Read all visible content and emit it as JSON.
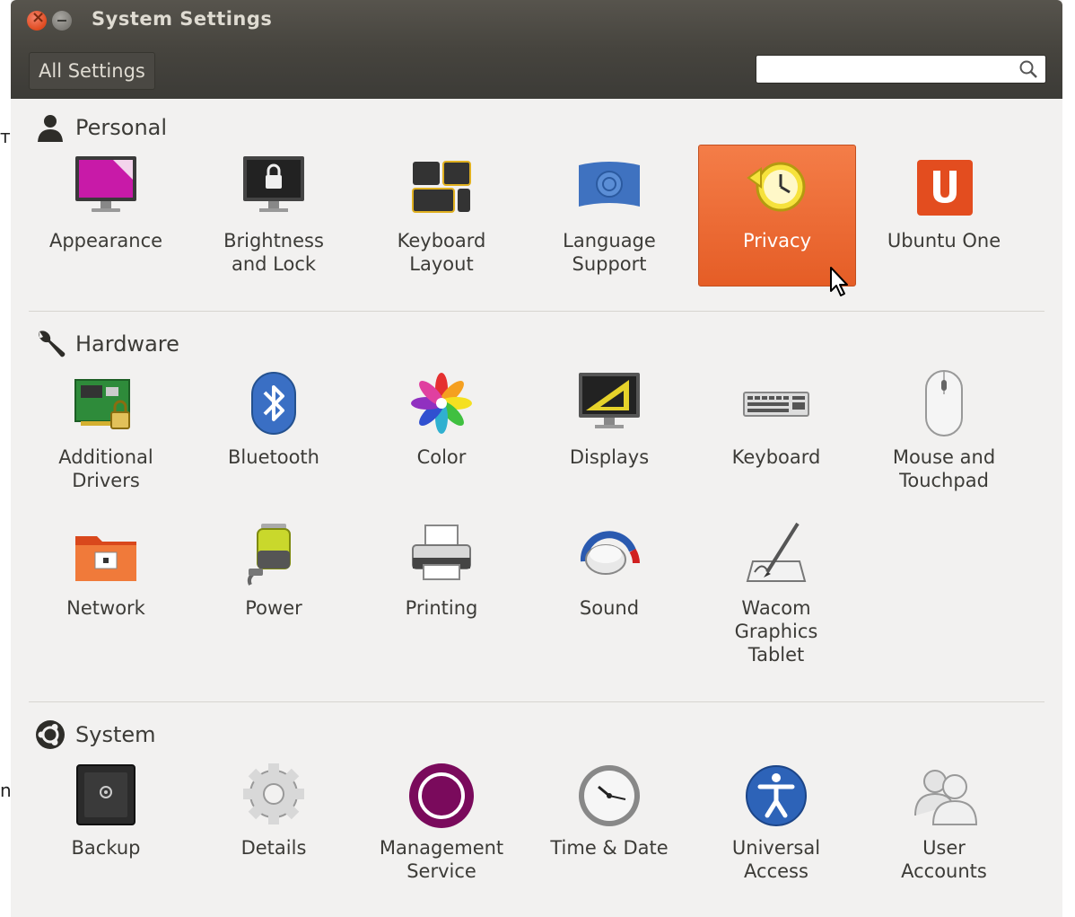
{
  "stray_text": {
    "top": "т",
    "bottom": "n"
  },
  "window": {
    "title": "System Settings",
    "all_settings_label": "All Settings",
    "search_placeholder": ""
  },
  "sections": {
    "personal": {
      "title": "Personal",
      "items": [
        {
          "label": "Appearance"
        },
        {
          "label": "Brightness\nand Lock"
        },
        {
          "label": "Keyboard\nLayout"
        },
        {
          "label": "Language\nSupport"
        },
        {
          "label": "Privacy",
          "selected": true
        },
        {
          "label": "Ubuntu One"
        }
      ]
    },
    "hardware": {
      "title": "Hardware",
      "items": [
        {
          "label": "Additional\nDrivers"
        },
        {
          "label": "Bluetooth"
        },
        {
          "label": "Color"
        },
        {
          "label": "Displays"
        },
        {
          "label": "Keyboard"
        },
        {
          "label": "Mouse and\nTouchpad"
        },
        {
          "label": "Network"
        },
        {
          "label": "Power"
        },
        {
          "label": "Printing"
        },
        {
          "label": "Sound"
        },
        {
          "label": "Wacom\nGraphics\nTablet"
        }
      ]
    },
    "system": {
      "title": "System",
      "items": [
        {
          "label": "Backup"
        },
        {
          "label": "Details"
        },
        {
          "label": "Management\nService"
        },
        {
          "label": "Time & Date"
        },
        {
          "label": "Universal\nAccess"
        },
        {
          "label": "User\nAccounts"
        }
      ]
    }
  },
  "colors": {
    "accent": "#e95420",
    "titlebar": "#3c3b37",
    "background": "#f2f1f0"
  }
}
